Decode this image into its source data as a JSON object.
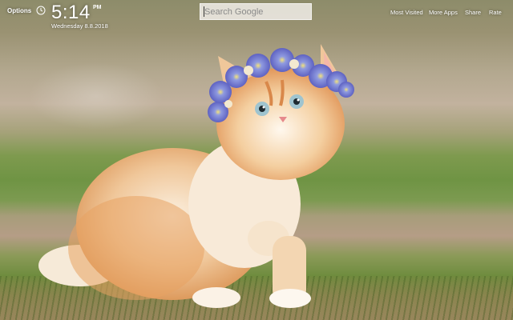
{
  "header": {
    "options_label": "Options",
    "clock": {
      "time": "5:14",
      "period": "PM",
      "date": "Wednesday  8.8.2018"
    }
  },
  "search": {
    "placeholder": "Search Google",
    "value": ""
  },
  "nav": {
    "most_visited": "Most Visited",
    "more_apps": "More Apps",
    "share": "Share",
    "rate": "Rate"
  },
  "icons": {
    "clock": "clock-icon"
  },
  "background": {
    "subject": "kitten-with-flower-crown"
  }
}
